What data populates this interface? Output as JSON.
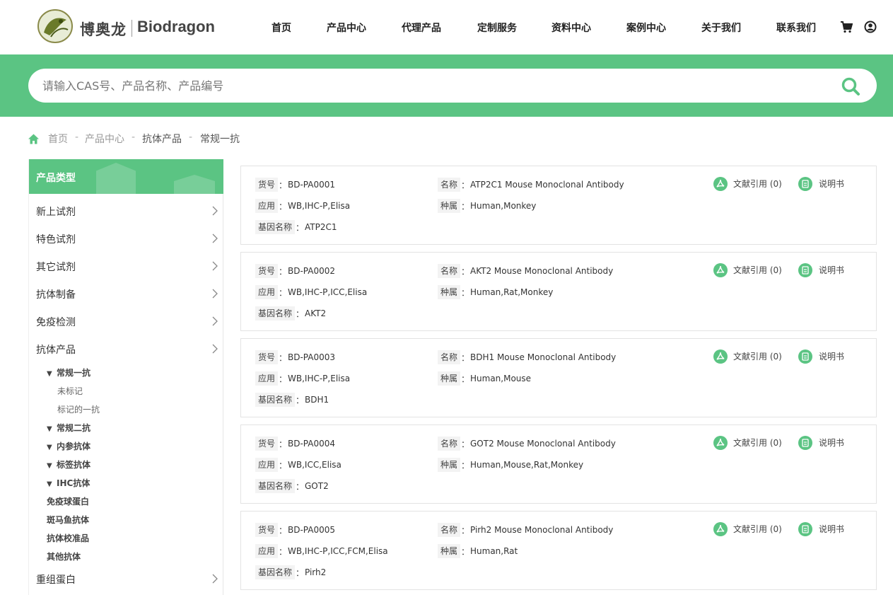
{
  "brand": {
    "cn": "博奥龙",
    "en": "Biodragon",
    "logo_icon": "biodragon-logo-icon"
  },
  "nav": [
    {
      "label": "首页"
    },
    {
      "label": "产品中心"
    },
    {
      "label": "代理产品"
    },
    {
      "label": "定制服务"
    },
    {
      "label": "资料中心"
    },
    {
      "label": "案例中心"
    },
    {
      "label": "关于我们"
    },
    {
      "label": "联系我们"
    }
  ],
  "header_icons": {
    "cart": "cart-icon",
    "user": "user-icon"
  },
  "search": {
    "placeholder": "请输入CAS号、产品名称、产品编号",
    "value": "",
    "icon": "search-icon"
  },
  "breadcrumb": {
    "home_icon": "home-icon",
    "separator": "-",
    "items": [
      "首页",
      "产品中心",
      "抗体产品",
      "常规一抗"
    ]
  },
  "sidebar": {
    "title": "产品类型",
    "items": [
      {
        "label": "新上试剂"
      },
      {
        "label": "特色试剂"
      },
      {
        "label": "其它试剂"
      },
      {
        "label": "抗体制备"
      },
      {
        "label": "免疫检测"
      },
      {
        "label": "抗体产品"
      }
    ],
    "subitems": [
      {
        "label": "常规一抗",
        "arrow": "▼"
      },
      {
        "label": "未标记"
      },
      {
        "label": "标记的一抗"
      },
      {
        "label": "常规二抗",
        "arrow": "▼"
      },
      {
        "label": "内参抗体",
        "arrow": "▼"
      },
      {
        "label": "标签抗体",
        "arrow": "▼"
      },
      {
        "label": "IHC抗体",
        "arrow": "▼"
      },
      {
        "label": "免疫球蛋白"
      },
      {
        "label": "斑马鱼抗体"
      },
      {
        "label": "抗体校准品"
      },
      {
        "label": "其他抗体"
      }
    ],
    "last_item": {
      "label": "重组蛋白"
    }
  },
  "labels": {
    "sku": "货号",
    "name": "名称",
    "app": "应用",
    "species": "种属",
    "gene": "基因名称",
    "colon": "：",
    "citations": "文献引用 (0)",
    "manual": "说明书"
  },
  "products": [
    {
      "sku": "BD-PA0001",
      "name": "ATP2C1 Mouse Monoclonal Antibody",
      "app": "WB,IHC-P,Elisa",
      "species": "Human,Monkey",
      "gene": "ATP2C1"
    },
    {
      "sku": "BD-PA0002",
      "name": "AKT2 Mouse Monoclonal Antibody",
      "app": "WB,IHC-P,ICC,Elisa",
      "species": "Human,Rat,Monkey",
      "gene": "AKT2"
    },
    {
      "sku": "BD-PA0003",
      "name": "BDH1 Mouse Monoclonal Antibody",
      "app": "WB,IHC-P,Elisa",
      "species": "Human,Mouse",
      "gene": "BDH1"
    },
    {
      "sku": "BD-PA0004",
      "name": "GOT2 Mouse Monoclonal Antibody",
      "app": "WB,ICC,Elisa",
      "species": "Human,Mouse,Rat,Monkey",
      "gene": "GOT2"
    },
    {
      "sku": "BD-PA0005",
      "name": "Pirh2 Mouse Monoclonal Antibody",
      "app": "WB,IHC-P,ICC,FCM,Elisa",
      "species": "Human,Rat",
      "gene": "Pirh2"
    }
  ],
  "colors": {
    "accent": "#5bc483",
    "text": "#333333",
    "muted": "#999999",
    "border": "#e3e3e3"
  }
}
